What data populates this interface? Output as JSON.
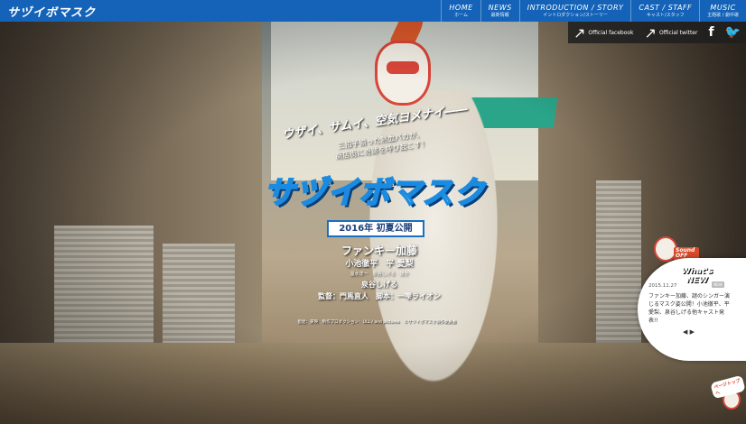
{
  "header": {
    "logo": "サヅイボマスク",
    "nav": [
      {
        "en": "HOME",
        "ja": "ホーム"
      },
      {
        "en": "NEWS",
        "ja": "最新情報"
      },
      {
        "en": "INTRODUCTION / STORY",
        "ja": "イントロダクション/ストーリー"
      },
      {
        "en": "CAST / STAFF",
        "ja": "キャスト/スタッフ"
      },
      {
        "en": "MUSIC",
        "ja": "主題歌 / 劇中歌"
      }
    ]
  },
  "social": {
    "facebook": "Official facebook",
    "twitter": "Official twitter",
    "facebook_icon": "f",
    "twitter_icon": "🐦"
  },
  "hero": {
    "tagline": "ウザイ、サムイ、空気ヨメナイ――",
    "subline": "三拍子揃った熱血バカが、\n商店街に奇跡を呼び起こす！",
    "title": "サヅイボマスク",
    "release": "2016年 初夏公開",
    "lead_cast": "ファンキー加藤",
    "cast2": "小池徹平　平 愛梨",
    "cast_small": "温水洋一　泉谷しげる　ほか",
    "director": "監督：門馬直人　脚本：一雫ライオン",
    "support": "泉谷しげる",
    "footer": "配給：東映　制作プロダクション：ULL / and pictures　©サヅイボマスク製作委員会"
  },
  "news": {
    "title": "What's NEW",
    "date": "2015.11.27",
    "badge": "NEW",
    "body": "ファンキー加藤、謎のシンガー演じるマスク姿公開！小池徹平、平愛梨、泉谷しげる他キャスト発表!!",
    "arrows": "◀ ▶"
  },
  "sound": {
    "label": "Sound OFF"
  },
  "pagetop": {
    "label": "ページトップへ"
  }
}
